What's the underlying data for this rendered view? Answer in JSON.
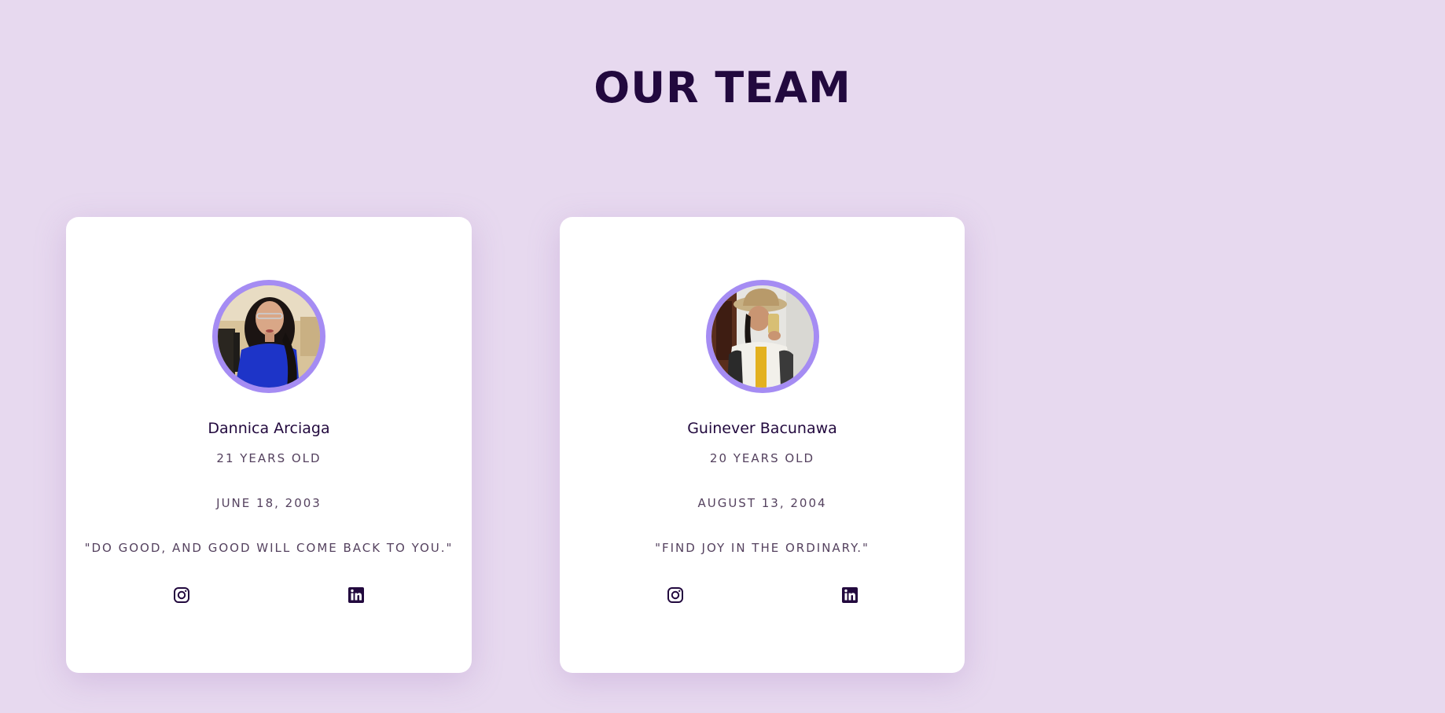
{
  "page": {
    "title": "OUR TEAM",
    "background": "#e7d9ef",
    "accent": "#a58cf3",
    "text_color": "#22093e"
  },
  "members": [
    {
      "name": "Dannica Arciaga",
      "age": "21 YEARS OLD",
      "birthday": "JUNE 18, 2003",
      "quote": "\"DO GOOD, AND GOOD WILL COME BACK TO YOU.\"",
      "photo_icon": "profile-photo",
      "socials": [
        "instagram-icon",
        "linkedin-icon"
      ]
    },
    {
      "name": "Guinever Bacunawa",
      "age": "20 YEARS OLD",
      "birthday": "AUGUST 13, 2004",
      "quote": "\"FIND JOY IN THE ORDINARY.\"",
      "photo_icon": "profile-photo",
      "socials": [
        "instagram-icon",
        "linkedin-icon"
      ]
    }
  ]
}
